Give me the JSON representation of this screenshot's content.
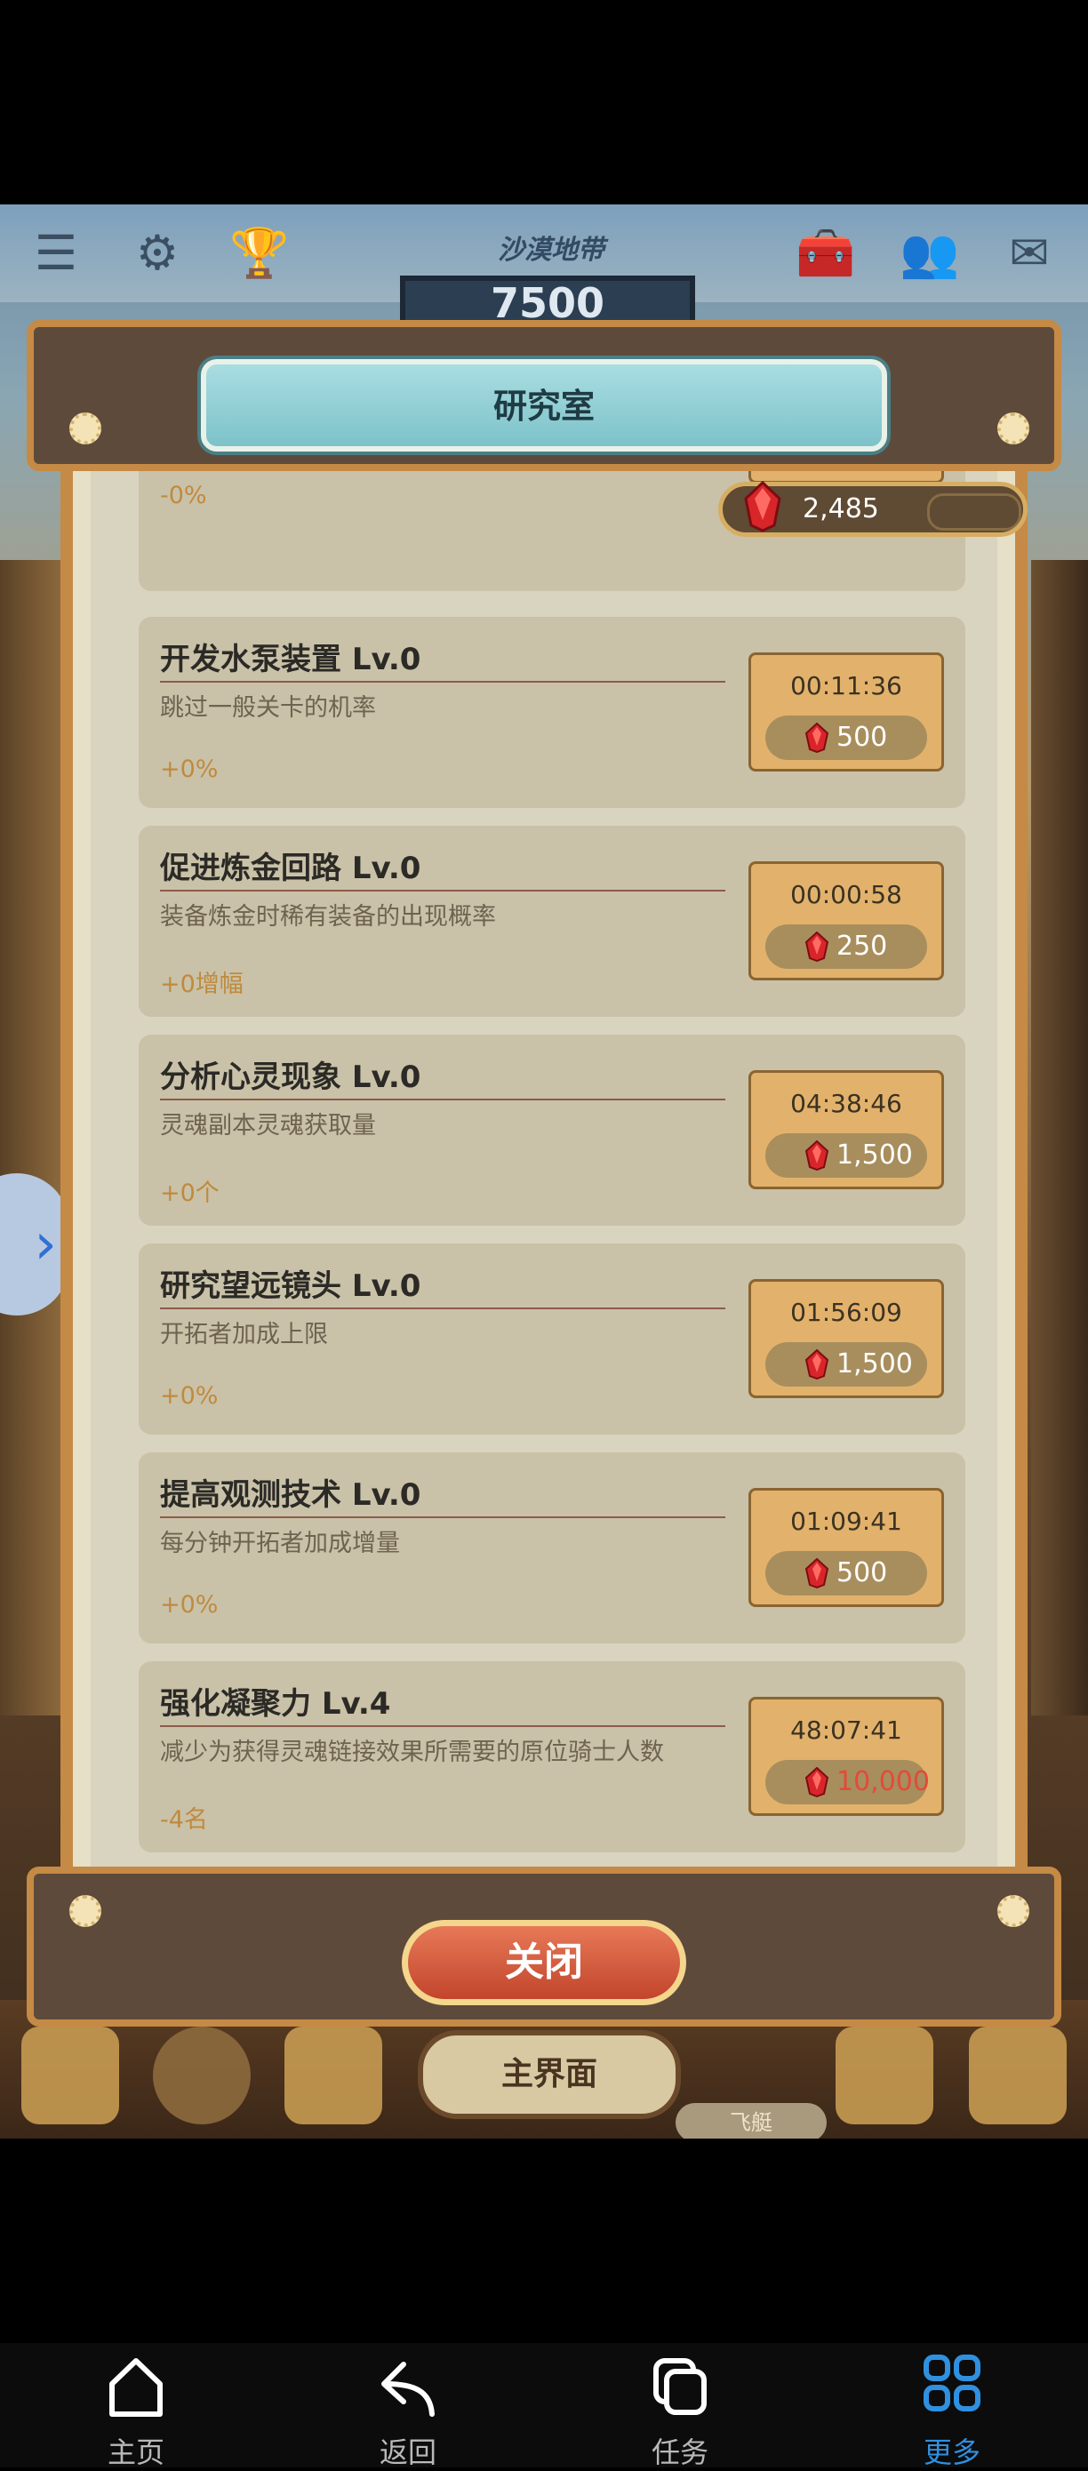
{
  "zone_title": "沙漠地带",
  "zone_score": "7500",
  "dialog_title": "研究室",
  "gem_balance": "2,485",
  "partial_card_bonus": "-0%",
  "research_items": [
    {
      "name": "开发水泵装置 Lv.0",
      "desc": "跳过一般关卡的机率",
      "bonus": "+0%",
      "time": "00:11:36",
      "cost": "500",
      "affordable": true
    },
    {
      "name": "促进炼金回路 Lv.0",
      "desc": "装备炼金时稀有装备的出现概率",
      "bonus": "+0增幅",
      "time": "00:00:58",
      "cost": "250",
      "affordable": true
    },
    {
      "name": "分析心灵现象 Lv.0",
      "desc": "灵魂副本灵魂获取量",
      "bonus": "+0个",
      "time": "04:38:46",
      "cost": "1,500",
      "affordable": true
    },
    {
      "name": "研究望远镜头 Lv.0",
      "desc": "开拓者加成上限",
      "bonus": "+0%",
      "time": "01:56:09",
      "cost": "1,500",
      "affordable": true
    },
    {
      "name": "提高观测技术 Lv.0",
      "desc": "每分钟开拓者加成增量",
      "bonus": "+0%",
      "time": "01:09:41",
      "cost": "500",
      "affordable": true
    },
    {
      "name": "强化凝聚力 Lv.4",
      "desc": "减少为获得灵魂链接效果所需要的原位骑士人数",
      "bonus": "-4名",
      "time": "48:07:41",
      "cost": "10,000",
      "affordable": false
    }
  ],
  "close_label": "关闭",
  "main_screen_label": "主界面",
  "airship_label": "飞艇",
  "nav": {
    "home": "主页",
    "back": "返回",
    "tasks": "任务",
    "more": "更多"
  },
  "colors": {
    "accent_nav": "#2f90e0",
    "cost_insufficient": "#e34a3a",
    "bonus_text": "#c08a3e"
  }
}
